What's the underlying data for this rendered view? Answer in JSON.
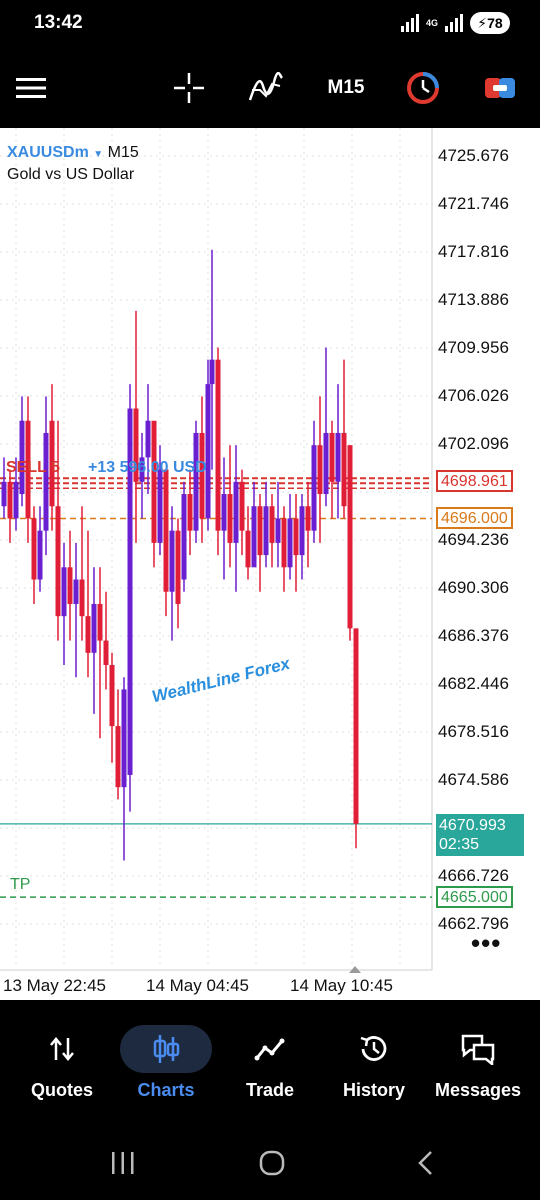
{
  "status": {
    "time": "13:42",
    "network": "4G",
    "battery": "78"
  },
  "toolbar": {
    "timeframe": "M15",
    "icons": [
      "menu-icon",
      "crosshair-icon",
      "indicators-icon",
      "timeframe-selector",
      "clock-icon",
      "trade-icon"
    ]
  },
  "chart": {
    "symbol": "XAUUSDm",
    "timeframe": "M15",
    "description": "Gold vs US Dollar",
    "price_axis": [
      "4725.676",
      "4721.746",
      "4717.816",
      "4713.886",
      "4709.956",
      "4706.026",
      "4702.096",
      "4694.236",
      "4690.306",
      "4686.376",
      "4682.446",
      "4678.516",
      "4674.586",
      "4666.726",
      "4662.796"
    ],
    "levels": {
      "sell": "4698.961",
      "sl": "4696.000",
      "current": "4670.993",
      "countdown": "02:35",
      "tp": "4665.000"
    },
    "sell_tag": "SELL 5",
    "profit_tag": "+13 596.00 USD",
    "sl_tag": "SL",
    "tp_tag": "TP",
    "watermark": "WealthLine Forex",
    "more": "•••",
    "time_axis": [
      "13 May 22:45",
      "14 May 04:45",
      "14 May 10:45"
    ],
    "colors": {
      "bull": "#6a1fd0",
      "bear": "#e01e37",
      "sell_line": "#d8352f",
      "sl_line": "#d97a1b",
      "tp_line": "#2e9a4b",
      "current_line": "#2aa79b"
    }
  },
  "nav": {
    "items": [
      {
        "label": "Quotes",
        "icon": "quotes-icon"
      },
      {
        "label": "Charts",
        "icon": "charts-icon",
        "active": true
      },
      {
        "label": "Trade",
        "icon": "trade-icon"
      },
      {
        "label": "History",
        "icon": "history-icon"
      },
      {
        "label": "Messages",
        "icon": "messages-icon"
      }
    ]
  },
  "system_nav": [
    "recents-button",
    "home-button",
    "back-button"
  ]
}
